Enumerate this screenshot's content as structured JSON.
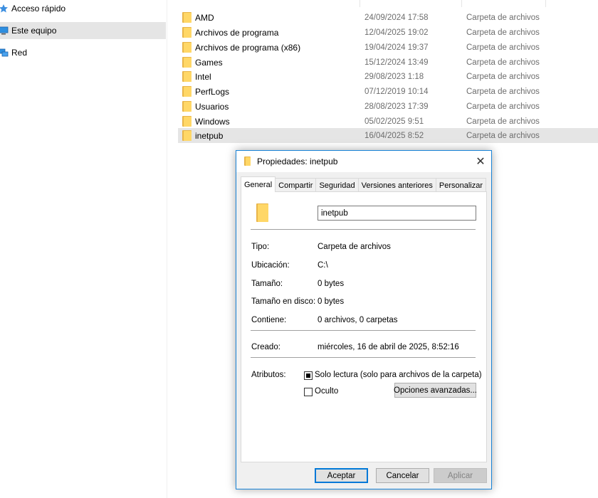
{
  "nav": {
    "items": [
      {
        "label": "Acceso rápido",
        "icon": "star-icon"
      },
      {
        "label": "Este equipo",
        "icon": "computer-icon",
        "selected": true
      },
      {
        "label": "Red",
        "icon": "network-icon"
      }
    ]
  },
  "files": [
    {
      "name": "AMD",
      "date": "24/09/2024 17:58",
      "type": "Carpeta de archivos"
    },
    {
      "name": "Archivos de programa",
      "date": "12/04/2025 19:02",
      "type": "Carpeta de archivos"
    },
    {
      "name": "Archivos de programa (x86)",
      "date": "19/04/2024 19:37",
      "type": "Carpeta de archivos"
    },
    {
      "name": "Games",
      "date": "15/12/2024 13:49",
      "type": "Carpeta de archivos"
    },
    {
      "name": "Intel",
      "date": "29/08/2023 1:18",
      "type": "Carpeta de archivos"
    },
    {
      "name": "PerfLogs",
      "date": "07/12/2019 10:14",
      "type": "Carpeta de archivos"
    },
    {
      "name": "Usuarios",
      "date": "28/08/2023 17:39",
      "type": "Carpeta de archivos"
    },
    {
      "name": "Windows",
      "date": "05/02/2025 9:51",
      "type": "Carpeta de archivos"
    },
    {
      "name": "inetpub",
      "date": "16/04/2025 8:52",
      "type": "Carpeta de archivos",
      "selected": true
    }
  ],
  "dialog": {
    "title": "Propiedades: inetpub",
    "close_glyph": "✕",
    "tabs": [
      "General",
      "Compartir",
      "Seguridad",
      "Versiones anteriores",
      "Personalizar"
    ],
    "active_tab": "General",
    "name_value": "inetpub",
    "props": {
      "tipo_label": "Tipo:",
      "tipo_value": "Carpeta de archivos",
      "ubicacion_label": "Ubicación:",
      "ubicacion_value": "C:\\",
      "tamano_label": "Tamaño:",
      "tamano_value": "0 bytes",
      "tamano_disco_label": "Tamaño en disco:",
      "tamano_disco_value": "0 bytes",
      "contiene_label": "Contiene:",
      "contiene_value": "0 archivos, 0 carpetas",
      "creado_label": "Creado:",
      "creado_value": "miércoles, 16 de abril de 2025, 8:52:16",
      "atributos_label": "Atributos:"
    },
    "attributes": {
      "solo_lectura": "Solo lectura (solo para archivos de la carpeta)",
      "oculto": "Oculto",
      "avanzadas": "Opciones avanzadas..."
    },
    "buttons": {
      "ok": "Aceptar",
      "cancel": "Cancelar",
      "apply": "Aplicar"
    }
  },
  "colors": {
    "accent": "#0078d7",
    "selection": "#e5e5e5",
    "folder": "#ffd767"
  }
}
